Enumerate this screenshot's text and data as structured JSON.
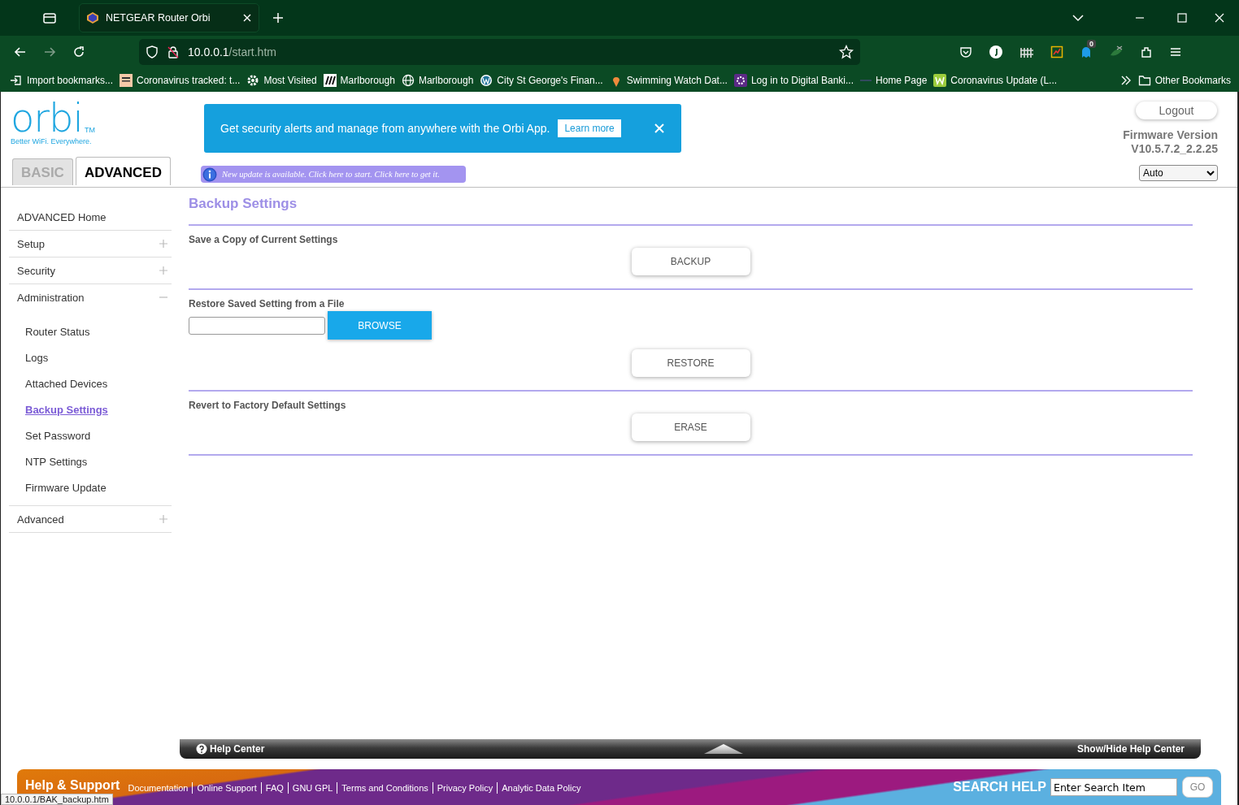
{
  "browser": {
    "tab_title": "NETGEAR Router Orbi",
    "url_host": "10.0.0.1",
    "url_path": "/start.htm",
    "extension_badge": "0",
    "bookmarks": [
      {
        "kind": "import",
        "label": "Import bookmarks..."
      },
      {
        "kind": "ft",
        "label": "Coronavirus tracked: t..."
      },
      {
        "kind": "gear",
        "label": "Most Visited"
      },
      {
        "kind": "stripes",
        "label": "Marlborough"
      },
      {
        "kind": "globe",
        "label": "Marlborough"
      },
      {
        "kind": "wp",
        "label": "City St George's Finan..."
      },
      {
        "kind": "pin",
        "label": "Swimming Watch Dat..."
      },
      {
        "kind": "flower",
        "label": "Log in to Digital Banki..."
      },
      {
        "kind": "dash",
        "label": "Home Page"
      },
      {
        "kind": "square",
        "label": "Coronavirus Update (L..."
      }
    ],
    "other_bookmarks": "Other Bookmarks"
  },
  "header": {
    "logo": "orbi",
    "logo_mark": "TM",
    "tagline": "Better WiFi. Everywhere.",
    "tabs": [
      {
        "label": "BASIC",
        "selected": false
      },
      {
        "label": "ADVANCED",
        "selected": true
      }
    ],
    "banner": {
      "text": "Get security alerts and manage from anywhere with the Orbi App.",
      "button": "Learn more"
    },
    "update_notice": "New update is available. Click here to start. Click here to get it.",
    "logout": "Logout",
    "firmware_label": "Firmware Version",
    "firmware_version": "V10.5.7.2_2.2.25",
    "language": "Auto"
  },
  "sidebar": {
    "items": [
      {
        "label": "ADVANCED Home",
        "selected": false
      },
      {
        "label": "Setup",
        "selected": false,
        "expanded": false
      },
      {
        "label": "Security",
        "selected": false,
        "expanded": false
      },
      {
        "label": "Administration",
        "selected": false,
        "expanded": true,
        "children": [
          {
            "label": "Router Status",
            "selected": false
          },
          {
            "label": "Logs",
            "selected": false
          },
          {
            "label": "Attached Devices",
            "selected": false
          },
          {
            "label": "Backup Settings",
            "selected": true
          },
          {
            "label": "Set Password",
            "selected": false
          },
          {
            "label": "NTP Settings",
            "selected": false
          },
          {
            "label": "Firmware Update",
            "selected": false
          }
        ]
      },
      {
        "label": "Advanced",
        "selected": false,
        "expanded": false
      }
    ]
  },
  "content": {
    "title": "Backup Settings",
    "sections": [
      {
        "kind": "button",
        "label": "Save a Copy of Current Settings",
        "button": "BACKUP"
      },
      {
        "kind": "file",
        "label": "Restore Saved Setting from a File",
        "browse": "BROWSE",
        "button": "RESTORE"
      },
      {
        "kind": "button",
        "label": "Revert to Factory Default Settings",
        "button": "ERASE"
      }
    ]
  },
  "help_bar": {
    "label": "Help Center",
    "toggle": "Show/Hide Help Center"
  },
  "footer": {
    "heading": "Help & Support",
    "links": [
      "Documentation",
      "Online Support",
      "FAQ",
      "GNU GPL",
      "Terms and Conditions",
      "Privacy Policy",
      "Analytic Data Policy"
    ],
    "search_label": "SEARCH HELP",
    "search_value": "Enter Search Item",
    "go": "GO"
  },
  "status_url": "10.0.0.1/BAK_backup.htm"
}
